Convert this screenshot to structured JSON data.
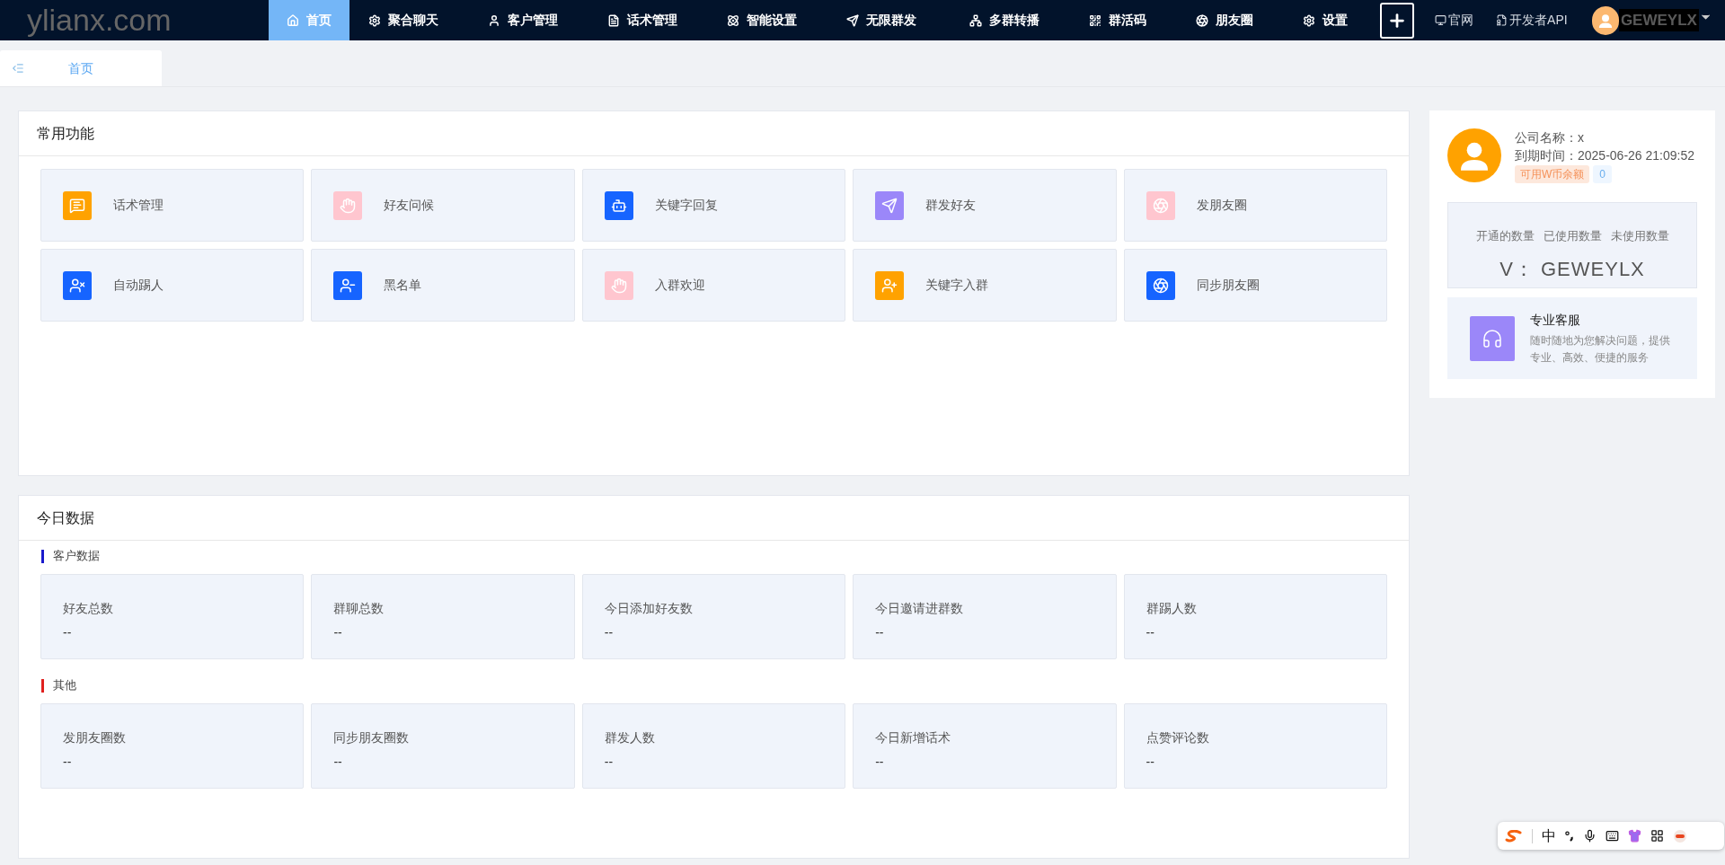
{
  "logo": "ylianx.com",
  "nav": [
    {
      "label": "首页",
      "selected": true
    },
    {
      "label": "聚合聊天",
      "selected": false
    },
    {
      "label": "客户管理",
      "selected": false
    },
    {
      "label": "话术管理",
      "selected": false
    },
    {
      "label": "智能设置",
      "selected": false
    },
    {
      "label": "无限群发",
      "selected": false
    },
    {
      "label": "多群转播",
      "selected": false
    },
    {
      "label": "群活码",
      "selected": false
    },
    {
      "label": "朋友圈",
      "selected": false
    },
    {
      "label": "设置",
      "selected": false
    }
  ],
  "header_links": [
    "官网",
    "开发者API"
  ],
  "user": {
    "name": "GEWEYLX"
  },
  "page_tabs": [
    {
      "label": "首页",
      "selected": true
    }
  ],
  "common_functions": {
    "title": "常用功能",
    "items": [
      {
        "label": "话术管理",
        "color": "#ffa200"
      },
      {
        "label": "好友问候",
        "color": "#ffc6cf"
      },
      {
        "label": "关键字回复",
        "color": "#1664ff"
      },
      {
        "label": "群发好友",
        "color": "#9b87f9"
      },
      {
        "label": "发朋友圈",
        "color": "#ffc6cf"
      },
      {
        "label": "自动踢人",
        "color": "#1664ff"
      },
      {
        "label": "黑名单",
        "color": "#1664ff"
      },
      {
        "label": "入群欢迎",
        "color": "#ffc6cf"
      },
      {
        "label": "关键字入群",
        "color": "#ffa200"
      },
      {
        "label": "同步朋友圈",
        "color": "#1664ff"
      }
    ]
  },
  "today_data": {
    "title": "今日数据",
    "groups": [
      {
        "title": "客户数据",
        "color": "#1a1acc",
        "stats": [
          {
            "label": "好友总数",
            "value": "--"
          },
          {
            "label": "群聊总数",
            "value": "--"
          },
          {
            "label": "今日添加好友数",
            "value": "--"
          },
          {
            "label": "今日邀请进群数",
            "value": "--"
          },
          {
            "label": "群踢人数",
            "value": "--"
          }
        ]
      },
      {
        "title": "其他",
        "color": "#e0201e",
        "stats": [
          {
            "label": "发朋友圈数",
            "value": "--"
          },
          {
            "label": "同步朋友圈数",
            "value": "--"
          },
          {
            "label": "群发人数",
            "value": "--"
          },
          {
            "label": "今日新增话术",
            "value": "--"
          },
          {
            "label": "点赞评论数",
            "value": "--"
          }
        ]
      }
    ]
  },
  "account": {
    "company": "公司名称：x",
    "expiry": "到期时间：2025-06-26 21:09:52",
    "balance_label": "可用W币余额",
    "balance": "0",
    "quota_labels": [
      "开通的数量",
      "已使用数量",
      "未使用数量"
    ],
    "quota_value": "V： GEWEYLX"
  },
  "service": {
    "title": "专业客服",
    "description": "随时随地为您解决问题，提供专业、高效、便捷的服务"
  },
  "ime_toolbar": {
    "mode": "中"
  }
}
